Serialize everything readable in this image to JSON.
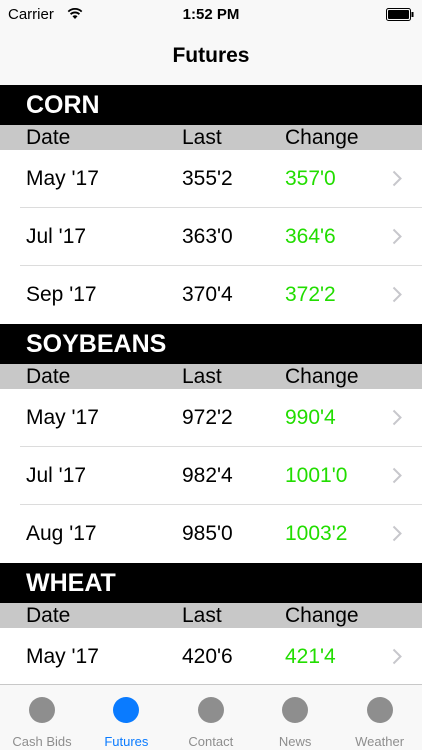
{
  "status_bar": {
    "carrier": "Carrier",
    "time": "1:52 PM"
  },
  "nav": {
    "title": "Futures"
  },
  "headers": {
    "date": "Date",
    "last": "Last",
    "change": "Change"
  },
  "sections": [
    {
      "title": "CORN",
      "rows": [
        {
          "date": "May '17",
          "last": "355'2",
          "change": "357'0"
        },
        {
          "date": "Jul '17",
          "last": "363'0",
          "change": "364'6"
        },
        {
          "date": "Sep '17",
          "last": "370'4",
          "change": "372'2"
        }
      ]
    },
    {
      "title": "SOYBEANS",
      "rows": [
        {
          "date": "May '17",
          "last": "972'2",
          "change": "990'4"
        },
        {
          "date": "Jul '17",
          "last": "982'4",
          "change": "1001'0"
        },
        {
          "date": "Aug '17",
          "last": "985'0",
          "change": "1003'2"
        }
      ]
    },
    {
      "title": "WHEAT",
      "rows": [
        {
          "date": "May '17",
          "last": "420'6",
          "change": "421'4"
        }
      ]
    }
  ],
  "tabs": [
    {
      "label": "Cash Bids",
      "active": false
    },
    {
      "label": "Futures",
      "active": true
    },
    {
      "label": "Contact",
      "active": false
    },
    {
      "label": "News",
      "active": false
    },
    {
      "label": "Weather",
      "active": false
    }
  ],
  "colors": {
    "accent": "#0a7bff",
    "positive_change": "#22dd00",
    "section_header": "#000000",
    "column_header": "#c8c8c8"
  },
  "icons": {
    "wifi": "wifi-icon",
    "battery": "battery-icon",
    "chevron": "chevron-right-icon",
    "tab": "circle-icon"
  }
}
